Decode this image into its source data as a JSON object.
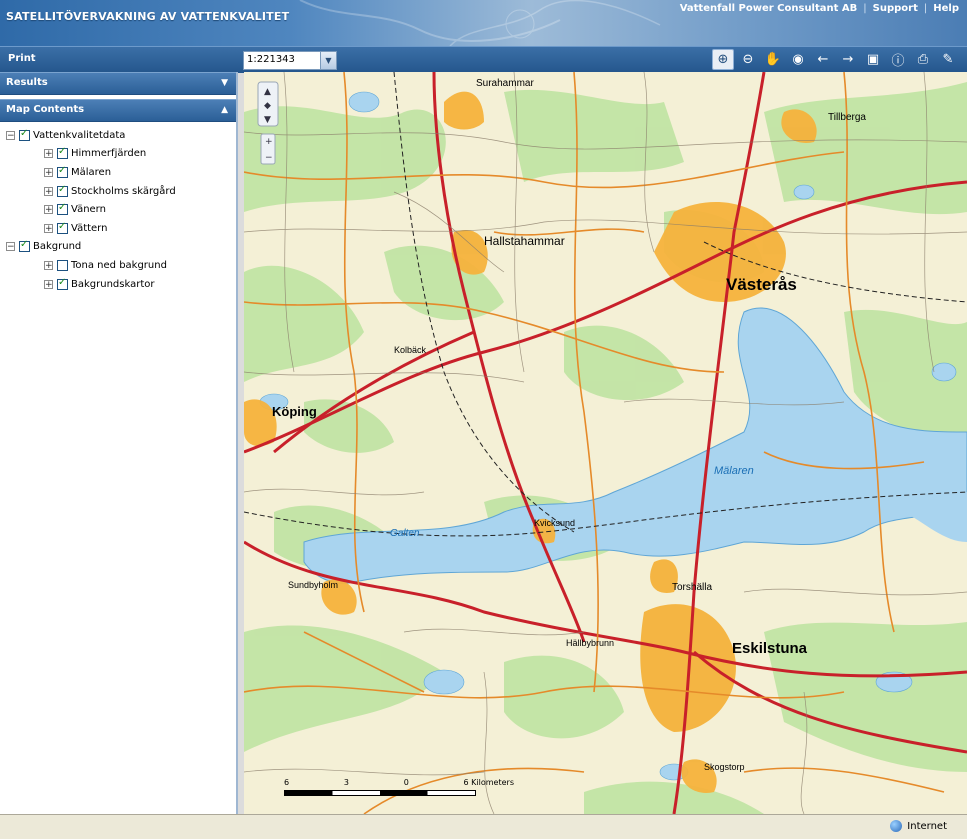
{
  "header": {
    "title": "SATELLITÖVERVAKNING AV VATTENKVALITET",
    "links": [
      "Vattenfall Power Consultant AB",
      "Support",
      "Help"
    ]
  },
  "toolbar": {
    "print_label": "Print",
    "scale_value": "1:221343",
    "tools": [
      "zoom-in-icon",
      "zoom-out-icon",
      "pan-hand-icon",
      "full-extent-globe-icon",
      "back-arrow-icon",
      "forward-arrow-icon",
      "layer-icon",
      "identify-info-icon",
      "print-icon",
      "measure-icon"
    ]
  },
  "results_panel": {
    "label": "Results"
  },
  "map_contents": {
    "label": "Map Contents",
    "groups": [
      {
        "label": "Vattenkvalitetdata",
        "checked": true,
        "children": [
          {
            "label": "Himmerfjärden",
            "checked": true
          },
          {
            "label": "Mälaren",
            "checked": true
          },
          {
            "label": "Stockholms skärgård",
            "checked": true
          },
          {
            "label": "Vänern",
            "checked": true
          },
          {
            "label": "Vättern",
            "checked": true
          }
        ]
      },
      {
        "label": "Bakgrund",
        "checked": true,
        "children": [
          {
            "label": "Tona ned bakgrund",
            "checked": false
          },
          {
            "label": "Bakgrundskartor",
            "checked": true
          }
        ]
      }
    ]
  },
  "map": {
    "labels": {
      "vasteras": "Västerås",
      "eskilstuna": "Eskilstuna",
      "koping": "Köping",
      "hallstahammar": "Hallstahammar",
      "surahammar": "Surahammar",
      "malaren": "Mälaren",
      "kolback": "Kolbäck",
      "tillberga": "Tillberga",
      "torshalla": "Torshälla",
      "hallbybrunn": "Hällbybrunn",
      "kvicksund": "Kvicksund",
      "skogstorp": "Skogstorp",
      "arboga_sund": "Sundbyholm",
      "galten": "Galten"
    },
    "scalebar": {
      "ticks": [
        "6",
        "3",
        "0",
        "6 Kilometers"
      ]
    }
  },
  "statusbar": {
    "zone_label": "Internet"
  }
}
